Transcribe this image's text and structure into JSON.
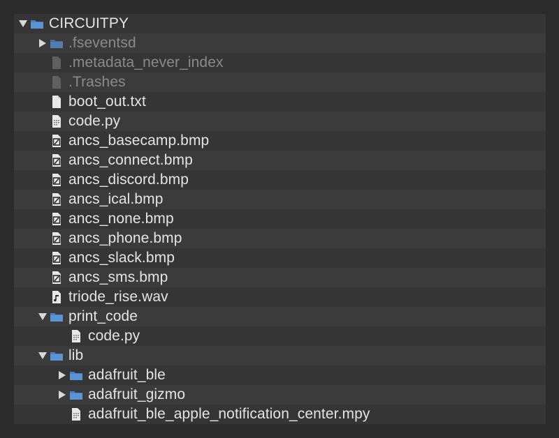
{
  "tree": {
    "items": [
      {
        "name": "CIRCUITPY",
        "kind": "folder",
        "expanded": true,
        "depth": 0,
        "dim": false
      },
      {
        "name": ".fseventsd",
        "kind": "folder",
        "expanded": false,
        "depth": 1,
        "dim": true
      },
      {
        "name": ".metadata_never_index",
        "kind": "file-blank",
        "depth": 1,
        "dim": true
      },
      {
        "name": ".Trashes",
        "kind": "file-blank",
        "depth": 1,
        "dim": true
      },
      {
        "name": "boot_out.txt",
        "kind": "file-text",
        "depth": 1,
        "dim": false
      },
      {
        "name": "code.py",
        "kind": "file-code",
        "depth": 1,
        "dim": false
      },
      {
        "name": "ancs_basecamp.bmp",
        "kind": "file-image",
        "depth": 1,
        "dim": false
      },
      {
        "name": "ancs_connect.bmp",
        "kind": "file-image",
        "depth": 1,
        "dim": false
      },
      {
        "name": "ancs_discord.bmp",
        "kind": "file-image",
        "depth": 1,
        "dim": false
      },
      {
        "name": "ancs_ical.bmp",
        "kind": "file-image",
        "depth": 1,
        "dim": false
      },
      {
        "name": "ancs_none.bmp",
        "kind": "file-image",
        "depth": 1,
        "dim": false
      },
      {
        "name": "ancs_phone.bmp",
        "kind": "file-image",
        "depth": 1,
        "dim": false
      },
      {
        "name": "ancs_slack.bmp",
        "kind": "file-image",
        "depth": 1,
        "dim": false
      },
      {
        "name": "ancs_sms.bmp",
        "kind": "file-image",
        "depth": 1,
        "dim": false
      },
      {
        "name": "triode_rise.wav",
        "kind": "file-audio",
        "depth": 1,
        "dim": false
      },
      {
        "name": "print_code",
        "kind": "folder",
        "expanded": true,
        "depth": 1,
        "dim": false
      },
      {
        "name": "code.py",
        "kind": "file-code",
        "depth": 2,
        "dim": false
      },
      {
        "name": "lib",
        "kind": "folder",
        "expanded": true,
        "depth": 1,
        "dim": false
      },
      {
        "name": "adafruit_ble",
        "kind": "folder",
        "expanded": false,
        "depth": 2,
        "dim": false
      },
      {
        "name": "adafruit_gizmo",
        "kind": "folder",
        "expanded": false,
        "depth": 2,
        "dim": false
      },
      {
        "name": "adafruit_ble_apple_notification_center.mpy",
        "kind": "file-code",
        "depth": 2,
        "dim": false
      }
    ]
  },
  "colors": {
    "background": "#2b2b2b",
    "panel": "#353535",
    "row_alt": "#3b3b3b",
    "text": "#e4e4e4",
    "text_dim": "#8a8a8a",
    "folder": "#4a7fc1"
  }
}
